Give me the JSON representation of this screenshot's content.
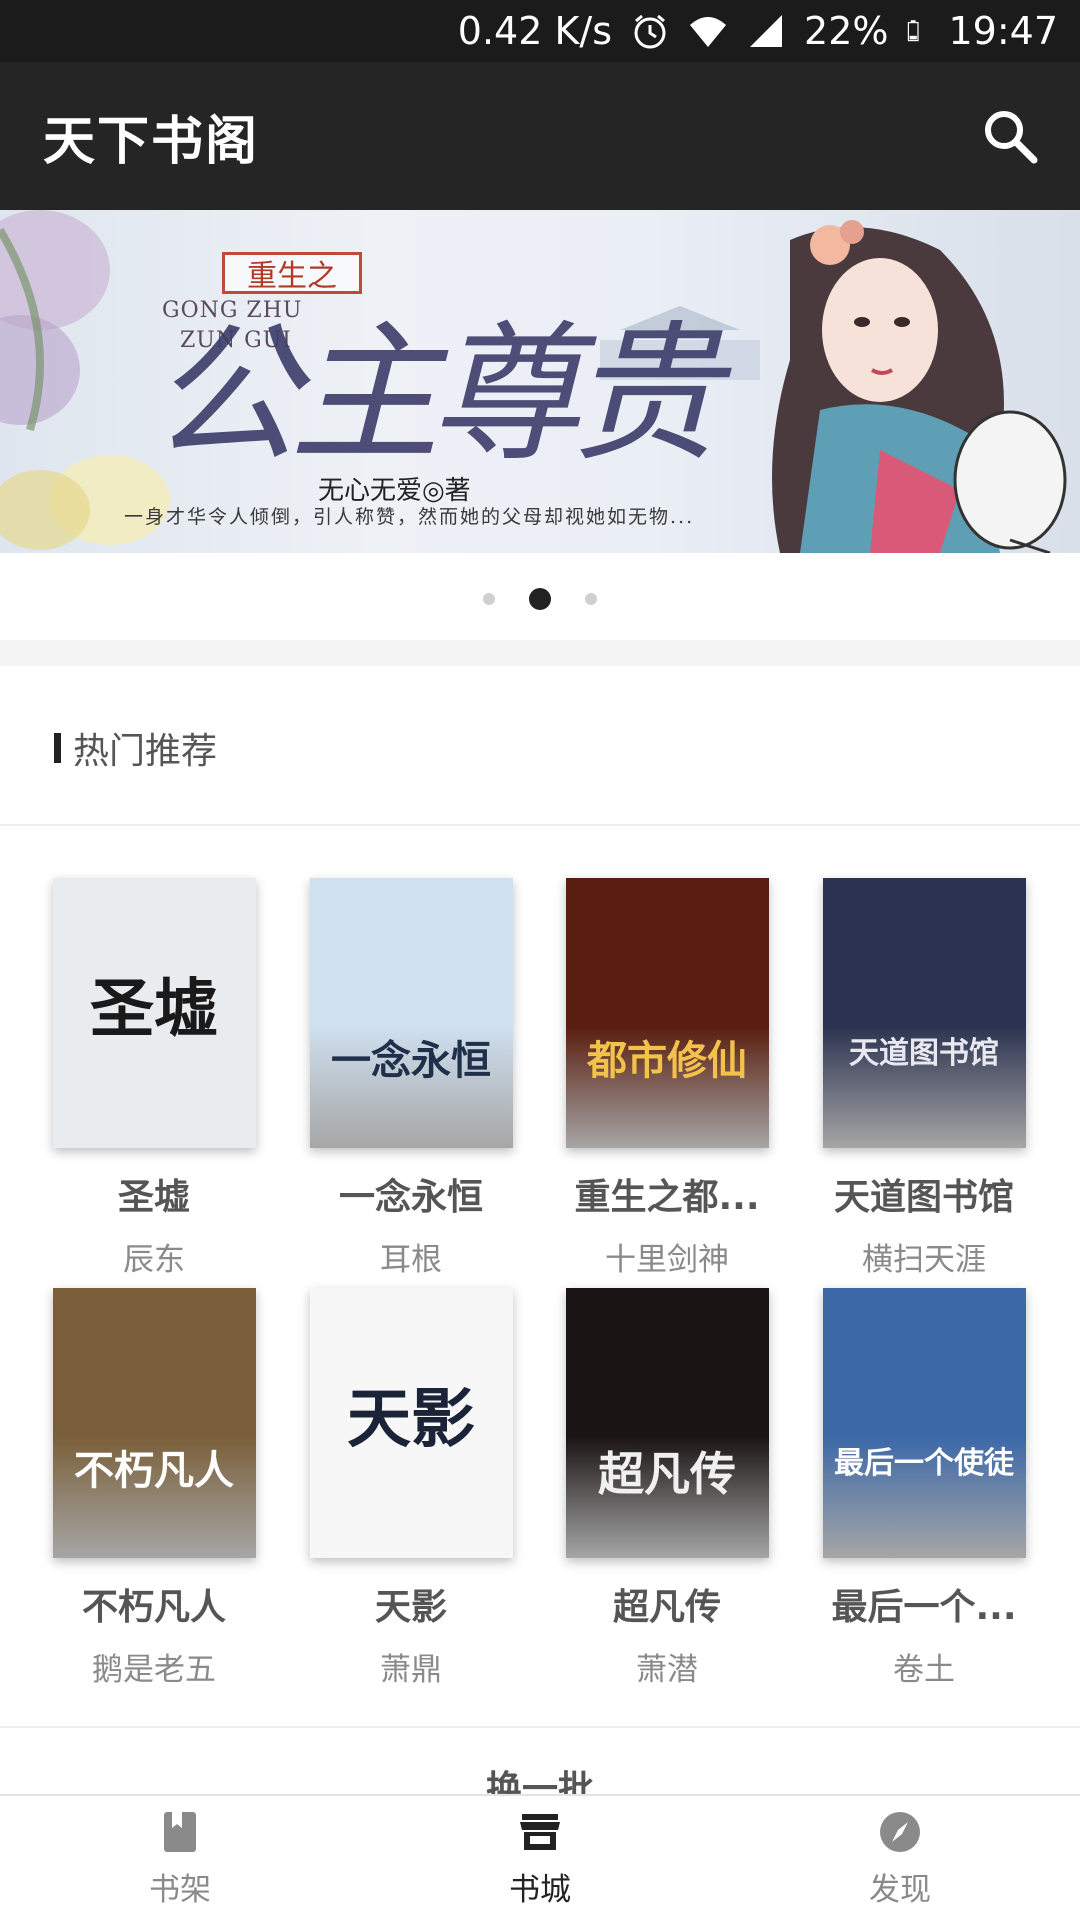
{
  "status_bar": {
    "speed": "0.42 K/s",
    "battery": "22%",
    "time": "19:47",
    "icons": [
      "alarm-icon",
      "wifi-icon",
      "signal-icon",
      "battery-icon"
    ]
  },
  "app_bar": {
    "title": "天下书阁",
    "search_icon": "search-icon"
  },
  "banner": {
    "tag": "重生之",
    "english": [
      "GONG ZHU",
      "ZUN GUI"
    ],
    "title": "公主尊贵",
    "author": "无心无爱◎著",
    "tagline": "一身才华令人倾倒，引人称赞，然而她的父母却视她如无物...",
    "active_slide": 2,
    "slide_count": 3
  },
  "section": {
    "title": "热门推荐"
  },
  "books": [
    {
      "title": "圣墟",
      "author": "辰东",
      "cover_text": "圣墟",
      "bg": "#e9ecef",
      "fg": "#1a1a1a"
    },
    {
      "title": "一念永恒",
      "author": "耳根",
      "cover_text": "一念永恒",
      "bg": "#cfe0ef",
      "fg": "#20304a"
    },
    {
      "title": "重生之都...",
      "author": "十里剑神",
      "cover_text": "都市修仙",
      "bg": "#5a1e10",
      "fg": "#f2c24a"
    },
    {
      "title": "天道图书馆",
      "author": "横扫天涯",
      "cover_text": "天道图书馆",
      "bg": "#2c3350",
      "fg": "#e8e8f0"
    },
    {
      "title": "不朽凡人",
      "author": "鹅是老五",
      "cover_text": "不朽凡人",
      "bg": "#7a5f3a",
      "fg": "#fff"
    },
    {
      "title": "天影",
      "author": "萧鼎",
      "cover_text": "天影",
      "bg": "#f7f7f7",
      "fg": "#1a2338"
    },
    {
      "title": "超凡传",
      "author": "萧潜",
      "cover_text": "超凡传",
      "bg": "#1a1414",
      "fg": "#f0f0f0"
    },
    {
      "title": "最后一个...",
      "author": "卷土",
      "cover_text": "最后一个使徒",
      "bg": "#3c68a8",
      "fg": "#ffffff"
    }
  ],
  "more_link": "换一批",
  "bottom_nav": [
    {
      "label": "书架",
      "icon": "bookshelf-icon",
      "active": false
    },
    {
      "label": "书城",
      "icon": "store-icon",
      "active": true
    },
    {
      "label": "发现",
      "icon": "compass-icon",
      "active": false
    }
  ]
}
